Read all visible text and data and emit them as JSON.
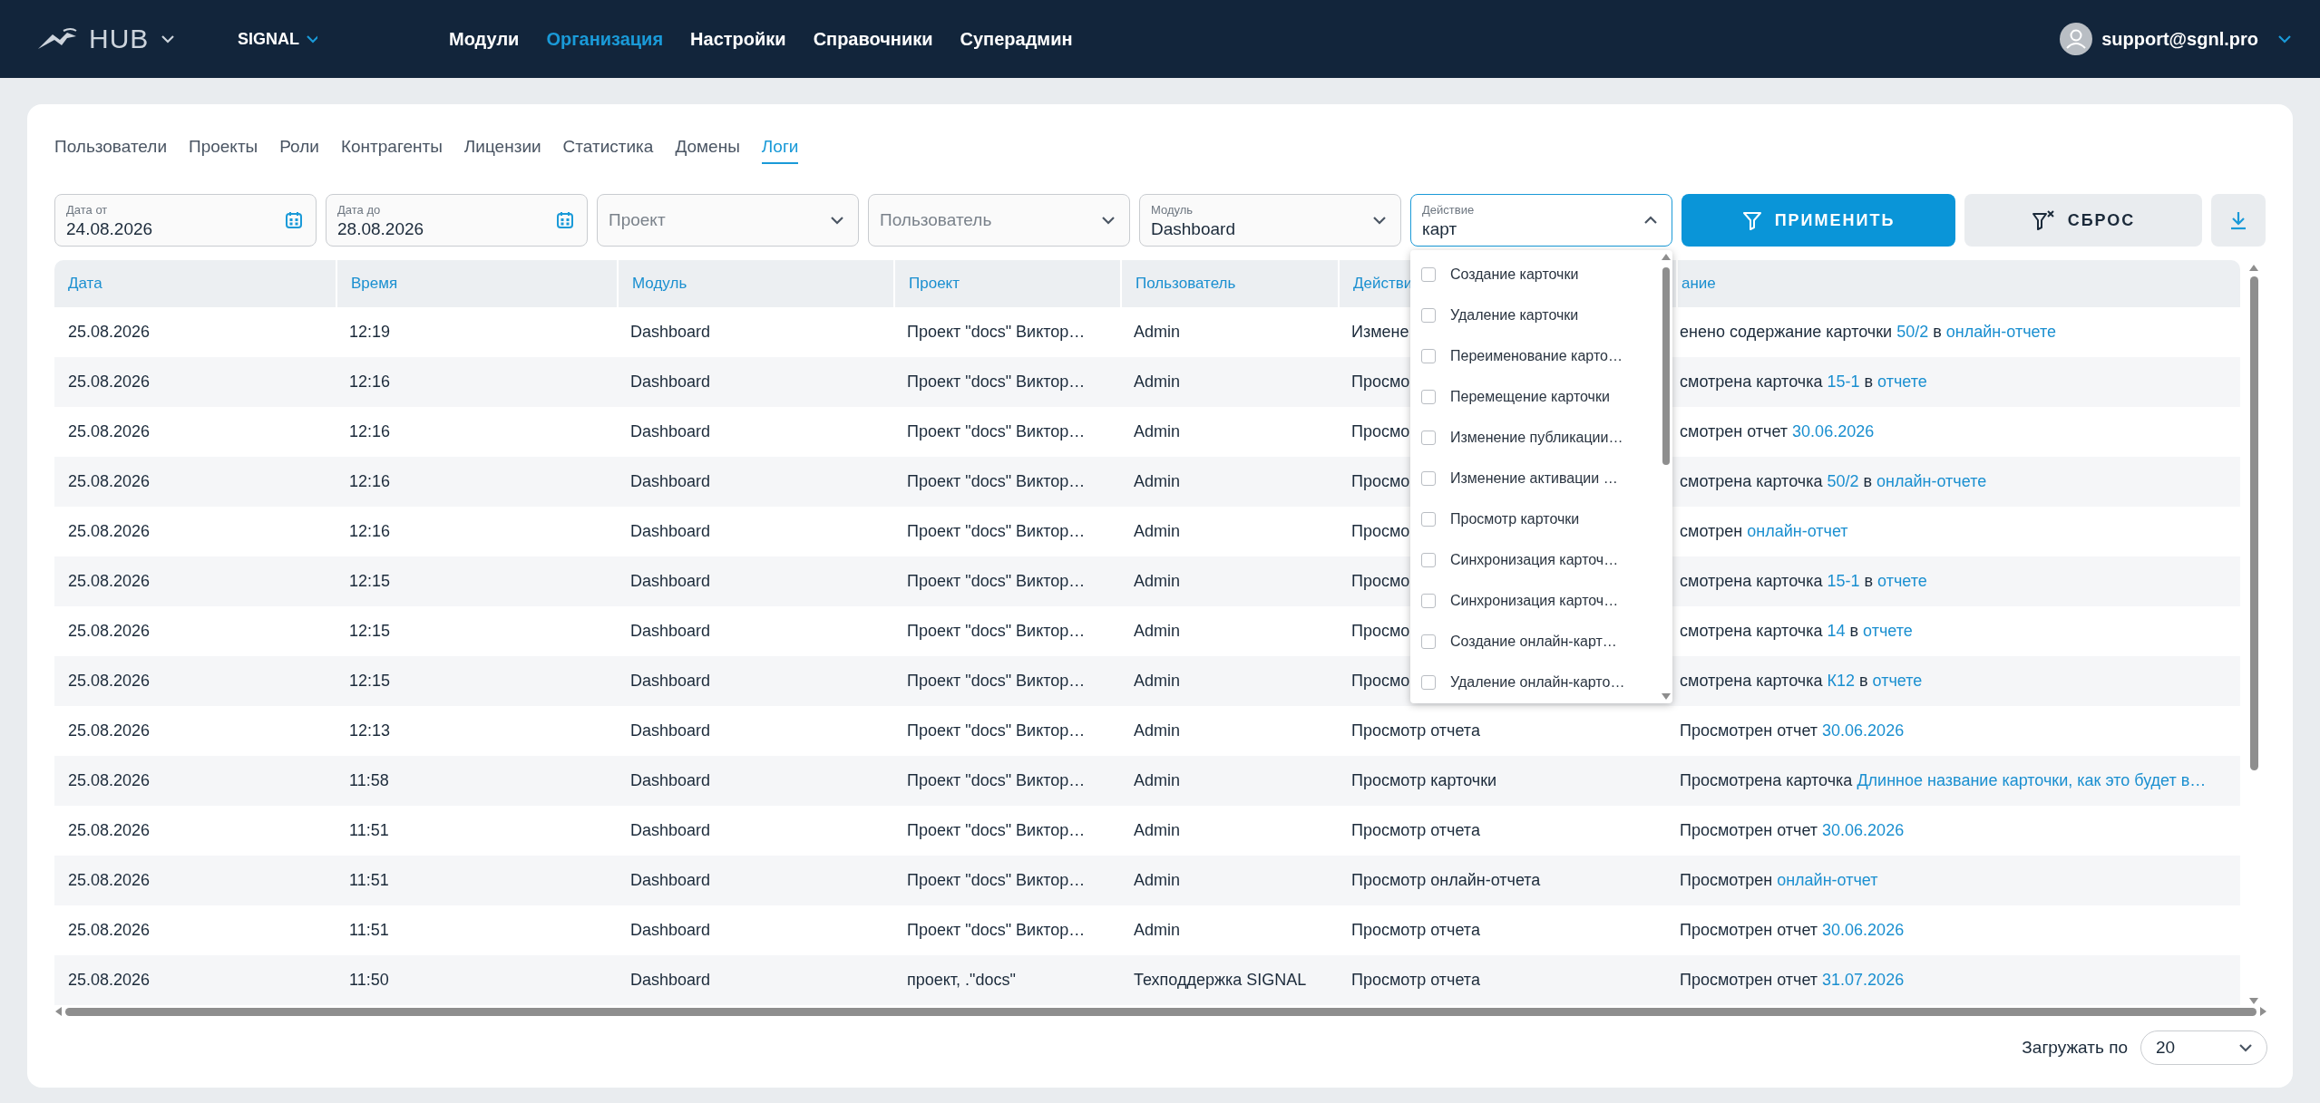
{
  "header": {
    "logo": "HUB",
    "workspace": "SIGNAL",
    "nav": [
      {
        "label": "Модули",
        "selected": false
      },
      {
        "label": "Организация",
        "selected": true
      },
      {
        "label": "Настройки",
        "selected": false
      },
      {
        "label": "Справочники",
        "selected": false
      },
      {
        "label": "Суперадмин",
        "selected": false
      }
    ],
    "user": "support@sgnl.pro"
  },
  "tabs": [
    {
      "label": "Пользователи",
      "selected": false
    },
    {
      "label": "Проекты",
      "selected": false
    },
    {
      "label": "Роли",
      "selected": false
    },
    {
      "label": "Контрагенты",
      "selected": false
    },
    {
      "label": "Лицензии",
      "selected": false
    },
    {
      "label": "Статистика",
      "selected": false
    },
    {
      "label": "Домены",
      "selected": false
    },
    {
      "label": "Логи",
      "selected": true
    }
  ],
  "filters": [
    {
      "kind": "date",
      "label": "Дата от",
      "value": "24.08.2026"
    },
    {
      "kind": "date",
      "label": "Дата до",
      "value": "28.08.2026"
    },
    {
      "kind": "select",
      "placeholder": "Проект",
      "expanded": false
    },
    {
      "kind": "select",
      "placeholder": "Пользователь",
      "expanded": false
    },
    {
      "kind": "select",
      "label": "Модуль",
      "value": "Dashboard",
      "expanded": false
    },
    {
      "kind": "select",
      "label": "Действие",
      "value": "карт",
      "expanded": true,
      "options": [
        {
          "label": "Создание карточки",
          "checked": false
        },
        {
          "label": "Удаление карточки",
          "checked": false
        },
        {
          "label": "Переименование карто…",
          "checked": false
        },
        {
          "label": "Перемещение карточки",
          "checked": false
        },
        {
          "label": "Изменение публикации…",
          "checked": false
        },
        {
          "label": "Изменение активации …",
          "checked": false
        },
        {
          "label": "Просмотр карточки",
          "checked": false
        },
        {
          "label": "Синхронизация карточ…",
          "checked": false
        },
        {
          "label": "Синхронизация карточ…",
          "checked": false
        },
        {
          "label": "Создание онлайн-карт…",
          "checked": false
        },
        {
          "label": "Удаление онлайн-карто…",
          "checked": false
        }
      ]
    }
  ],
  "buttons": [
    {
      "kind": "primary",
      "label": "ПРИМЕНИТЬ"
    },
    {
      "kind": "secondary",
      "label": "СБРОС"
    },
    {
      "kind": "download"
    }
  ],
  "table": {
    "columns": [
      "Дата",
      "Время",
      "Модуль",
      "Проект",
      "Пользователь",
      "Действи",
      "ание"
    ],
    "rows": [
      {
        "date": "25.08.2026",
        "time": "12:19",
        "module": "Dashboard",
        "project": "Проект \"docs\" Виктор…",
        "user": "Admin",
        "action": "Измене",
        "description": [
          {
            "kind": "text",
            "text": "енено содержание карточки "
          },
          {
            "kind": "link",
            "text": "50/2"
          },
          {
            "kind": "text",
            "text": " в "
          },
          {
            "kind": "link",
            "text": "онлайн-отчете"
          }
        ]
      },
      {
        "date": "25.08.2026",
        "time": "12:16",
        "module": "Dashboard",
        "project": "Проект \"docs\" Виктор…",
        "user": "Admin",
        "action": "Просмо",
        "description": [
          {
            "kind": "text",
            "text": "смотрена карточка "
          },
          {
            "kind": "link",
            "text": "15-1"
          },
          {
            "kind": "text",
            "text": " в "
          },
          {
            "kind": "link",
            "text": "отчете"
          }
        ]
      },
      {
        "date": "25.08.2026",
        "time": "12:16",
        "module": "Dashboard",
        "project": "Проект \"docs\" Виктор…",
        "user": "Admin",
        "action": "Просмо",
        "description": [
          {
            "kind": "text",
            "text": "смотрен отчет "
          },
          {
            "kind": "link",
            "text": "30.06.2026"
          }
        ]
      },
      {
        "date": "25.08.2026",
        "time": "12:16",
        "module": "Dashboard",
        "project": "Проект \"docs\" Виктор…",
        "user": "Admin",
        "action": "Просмо",
        "description": [
          {
            "kind": "text",
            "text": "смотрена карточка "
          },
          {
            "kind": "link",
            "text": "50/2"
          },
          {
            "kind": "text",
            "text": " в "
          },
          {
            "kind": "link",
            "text": "онлайн-отчете"
          }
        ]
      },
      {
        "date": "25.08.2026",
        "time": "12:16",
        "module": "Dashboard",
        "project": "Проект \"docs\" Виктор…",
        "user": "Admin",
        "action": "Просмо",
        "description": [
          {
            "kind": "text",
            "text": "смотрен "
          },
          {
            "kind": "link",
            "text": "онлайн-отчет"
          }
        ]
      },
      {
        "date": "25.08.2026",
        "time": "12:15",
        "module": "Dashboard",
        "project": "Проект \"docs\" Виктор…",
        "user": "Admin",
        "action": "Просмо",
        "description": [
          {
            "kind": "text",
            "text": "смотрена карточка "
          },
          {
            "kind": "link",
            "text": "15-1"
          },
          {
            "kind": "text",
            "text": " в "
          },
          {
            "kind": "link",
            "text": "отчете"
          }
        ]
      },
      {
        "date": "25.08.2026",
        "time": "12:15",
        "module": "Dashboard",
        "project": "Проект \"docs\" Виктор…",
        "user": "Admin",
        "action": "Просмо",
        "description": [
          {
            "kind": "text",
            "text": "смотрена карточка "
          },
          {
            "kind": "link",
            "text": "14"
          },
          {
            "kind": "text",
            "text": " в "
          },
          {
            "kind": "link",
            "text": "отчете"
          }
        ]
      },
      {
        "date": "25.08.2026",
        "time": "12:15",
        "module": "Dashboard",
        "project": "Проект \"docs\" Виктор…",
        "user": "Admin",
        "action": "Просмо",
        "description": [
          {
            "kind": "text",
            "text": "смотрена карточка "
          },
          {
            "kind": "link",
            "text": "К12"
          },
          {
            "kind": "text",
            "text": " в "
          },
          {
            "kind": "link",
            "text": "отчете"
          }
        ]
      },
      {
        "date": "25.08.2026",
        "time": "12:13",
        "module": "Dashboard",
        "project": "Проект \"docs\" Виктор…",
        "user": "Admin",
        "action": "Просмотр отчета",
        "description": [
          {
            "kind": "text",
            "text": "Просмотрен отчет "
          },
          {
            "kind": "link",
            "text": "30.06.2026"
          }
        ]
      },
      {
        "date": "25.08.2026",
        "time": "11:58",
        "module": "Dashboard",
        "project": "Проект \"docs\" Виктор…",
        "user": "Admin",
        "action": "Просмотр карточки",
        "description": [
          {
            "kind": "text",
            "text": "Просмотрена карточка "
          },
          {
            "kind": "link",
            "text": "Длинное название карточки, как это будет в…"
          }
        ]
      },
      {
        "date": "25.08.2026",
        "time": "11:51",
        "module": "Dashboard",
        "project": "Проект \"docs\" Виктор…",
        "user": "Admin",
        "action": "Просмотр отчета",
        "description": [
          {
            "kind": "text",
            "text": "Просмотрен отчет "
          },
          {
            "kind": "link",
            "text": "30.06.2026"
          }
        ]
      },
      {
        "date": "25.08.2026",
        "time": "11:51",
        "module": "Dashboard",
        "project": "Проект \"docs\" Виктор…",
        "user": "Admin",
        "action": "Просмотр онлайн-отчета",
        "description": [
          {
            "kind": "text",
            "text": "Просмотрен "
          },
          {
            "kind": "link",
            "text": "онлайн-отчет"
          }
        ]
      },
      {
        "date": "25.08.2026",
        "time": "11:51",
        "module": "Dashboard",
        "project": "Проект \"docs\" Виктор…",
        "user": "Admin",
        "action": "Просмотр отчета",
        "description": [
          {
            "kind": "text",
            "text": "Просмотрен отчет "
          },
          {
            "kind": "link",
            "text": "30.06.2026"
          }
        ]
      },
      {
        "date": "25.08.2026",
        "time": "11:50",
        "module": "Dashboard",
        "project": "проект, .\"docs\"",
        "user": "Техподдержка SIGNAL",
        "action": "Просмотр отчета",
        "description": [
          {
            "kind": "text",
            "text": "Просмотрен отчет "
          },
          {
            "kind": "link",
            "text": "31.07.2026"
          }
        ]
      }
    ]
  },
  "footer": {
    "label": "Загружать по",
    "page_size": "20"
  }
}
